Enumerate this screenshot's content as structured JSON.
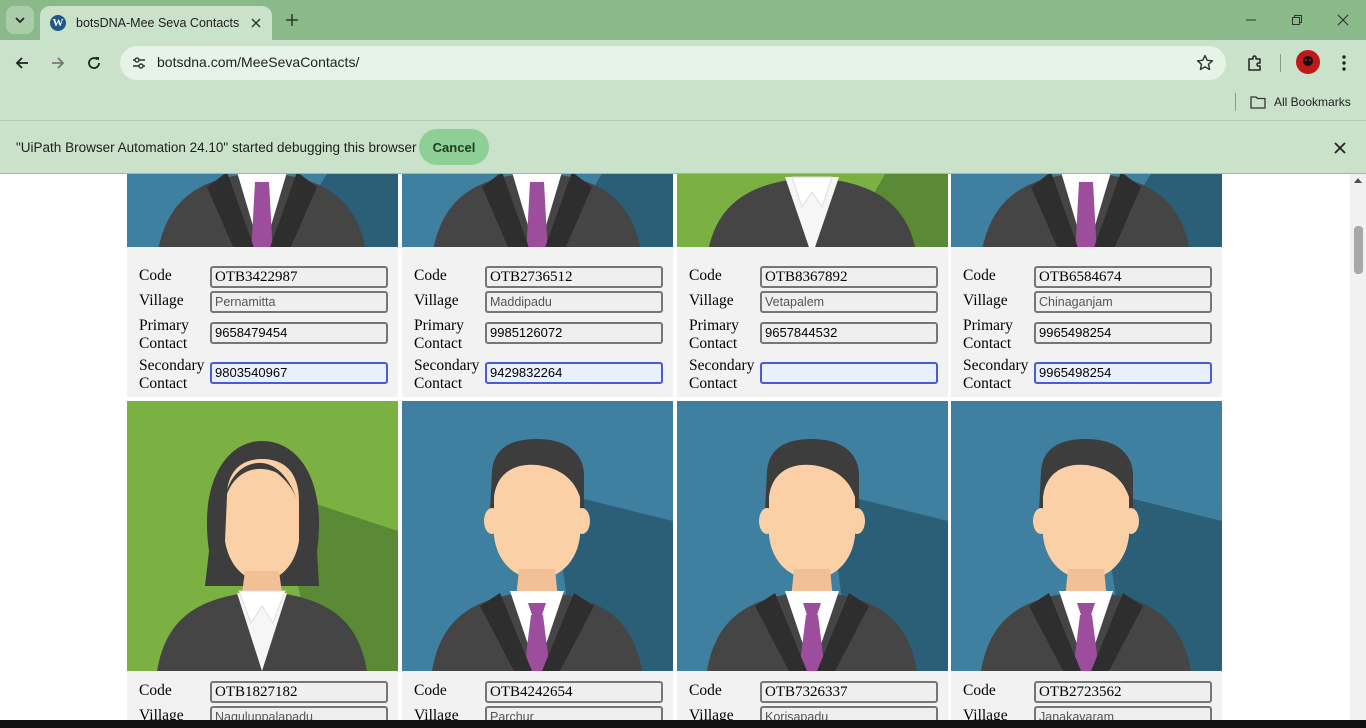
{
  "browser": {
    "tab_title": "botsDNA-Mee Seva Contacts",
    "favicon_letter": "W",
    "url": "botsdna.com/MeeSevaContacts/",
    "bookmarks_label": "All Bookmarks",
    "tab_strip_color": "#8ab98a",
    "toolbar_color": "#c9e2c9"
  },
  "infobar": {
    "message": "\"UiPath Browser Automation 24.10\" started debugging this browser",
    "cancel_label": "Cancel"
  },
  "field_labels": {
    "code": "Code",
    "village": "Village",
    "primary_1": "Primary",
    "primary_2": "Contact",
    "secondary_1": "Secondary",
    "secondary_2": "Contact"
  },
  "rows": [
    {
      "contacts": [
        {
          "avatar": "male-avatar-icon",
          "code": "OTB3422987",
          "village": "Pernamitta",
          "primary": "9658479454",
          "secondary": "9803540967"
        },
        {
          "avatar": "male-avatar-icon",
          "code": "OTB2736512",
          "village": "Maddipadu",
          "primary": "9985126072",
          "secondary": "9429832264"
        },
        {
          "avatar": "female-avatar-icon",
          "code": "OTB8367892",
          "village": "Vetapalem",
          "primary": "9657844532",
          "secondary": ""
        },
        {
          "avatar": "male-avatar-icon",
          "code": "OTB6584674",
          "village": "Chinaganjam",
          "primary": "9965498254",
          "secondary": "9965498254"
        }
      ]
    },
    {
      "contacts": [
        {
          "avatar": "female-avatar-icon",
          "code": "OTB1827182",
          "village": "Naguluppalapadu"
        },
        {
          "avatar": "male-avatar-icon",
          "code": "OTB4242654",
          "village": "Parchur"
        },
        {
          "avatar": "male-avatar-icon",
          "code": "OTB7326337",
          "village": "Korisapadu"
        },
        {
          "avatar": "male-avatar-icon",
          "code": "OTB2723562",
          "village": "Janakavaram"
        }
      ]
    }
  ],
  "colors": {
    "male_bg": "#3f7fa0",
    "female_bg": "#7bb043",
    "focus_border": "#4a5bd6",
    "cancel_button": "#8ecf95"
  }
}
